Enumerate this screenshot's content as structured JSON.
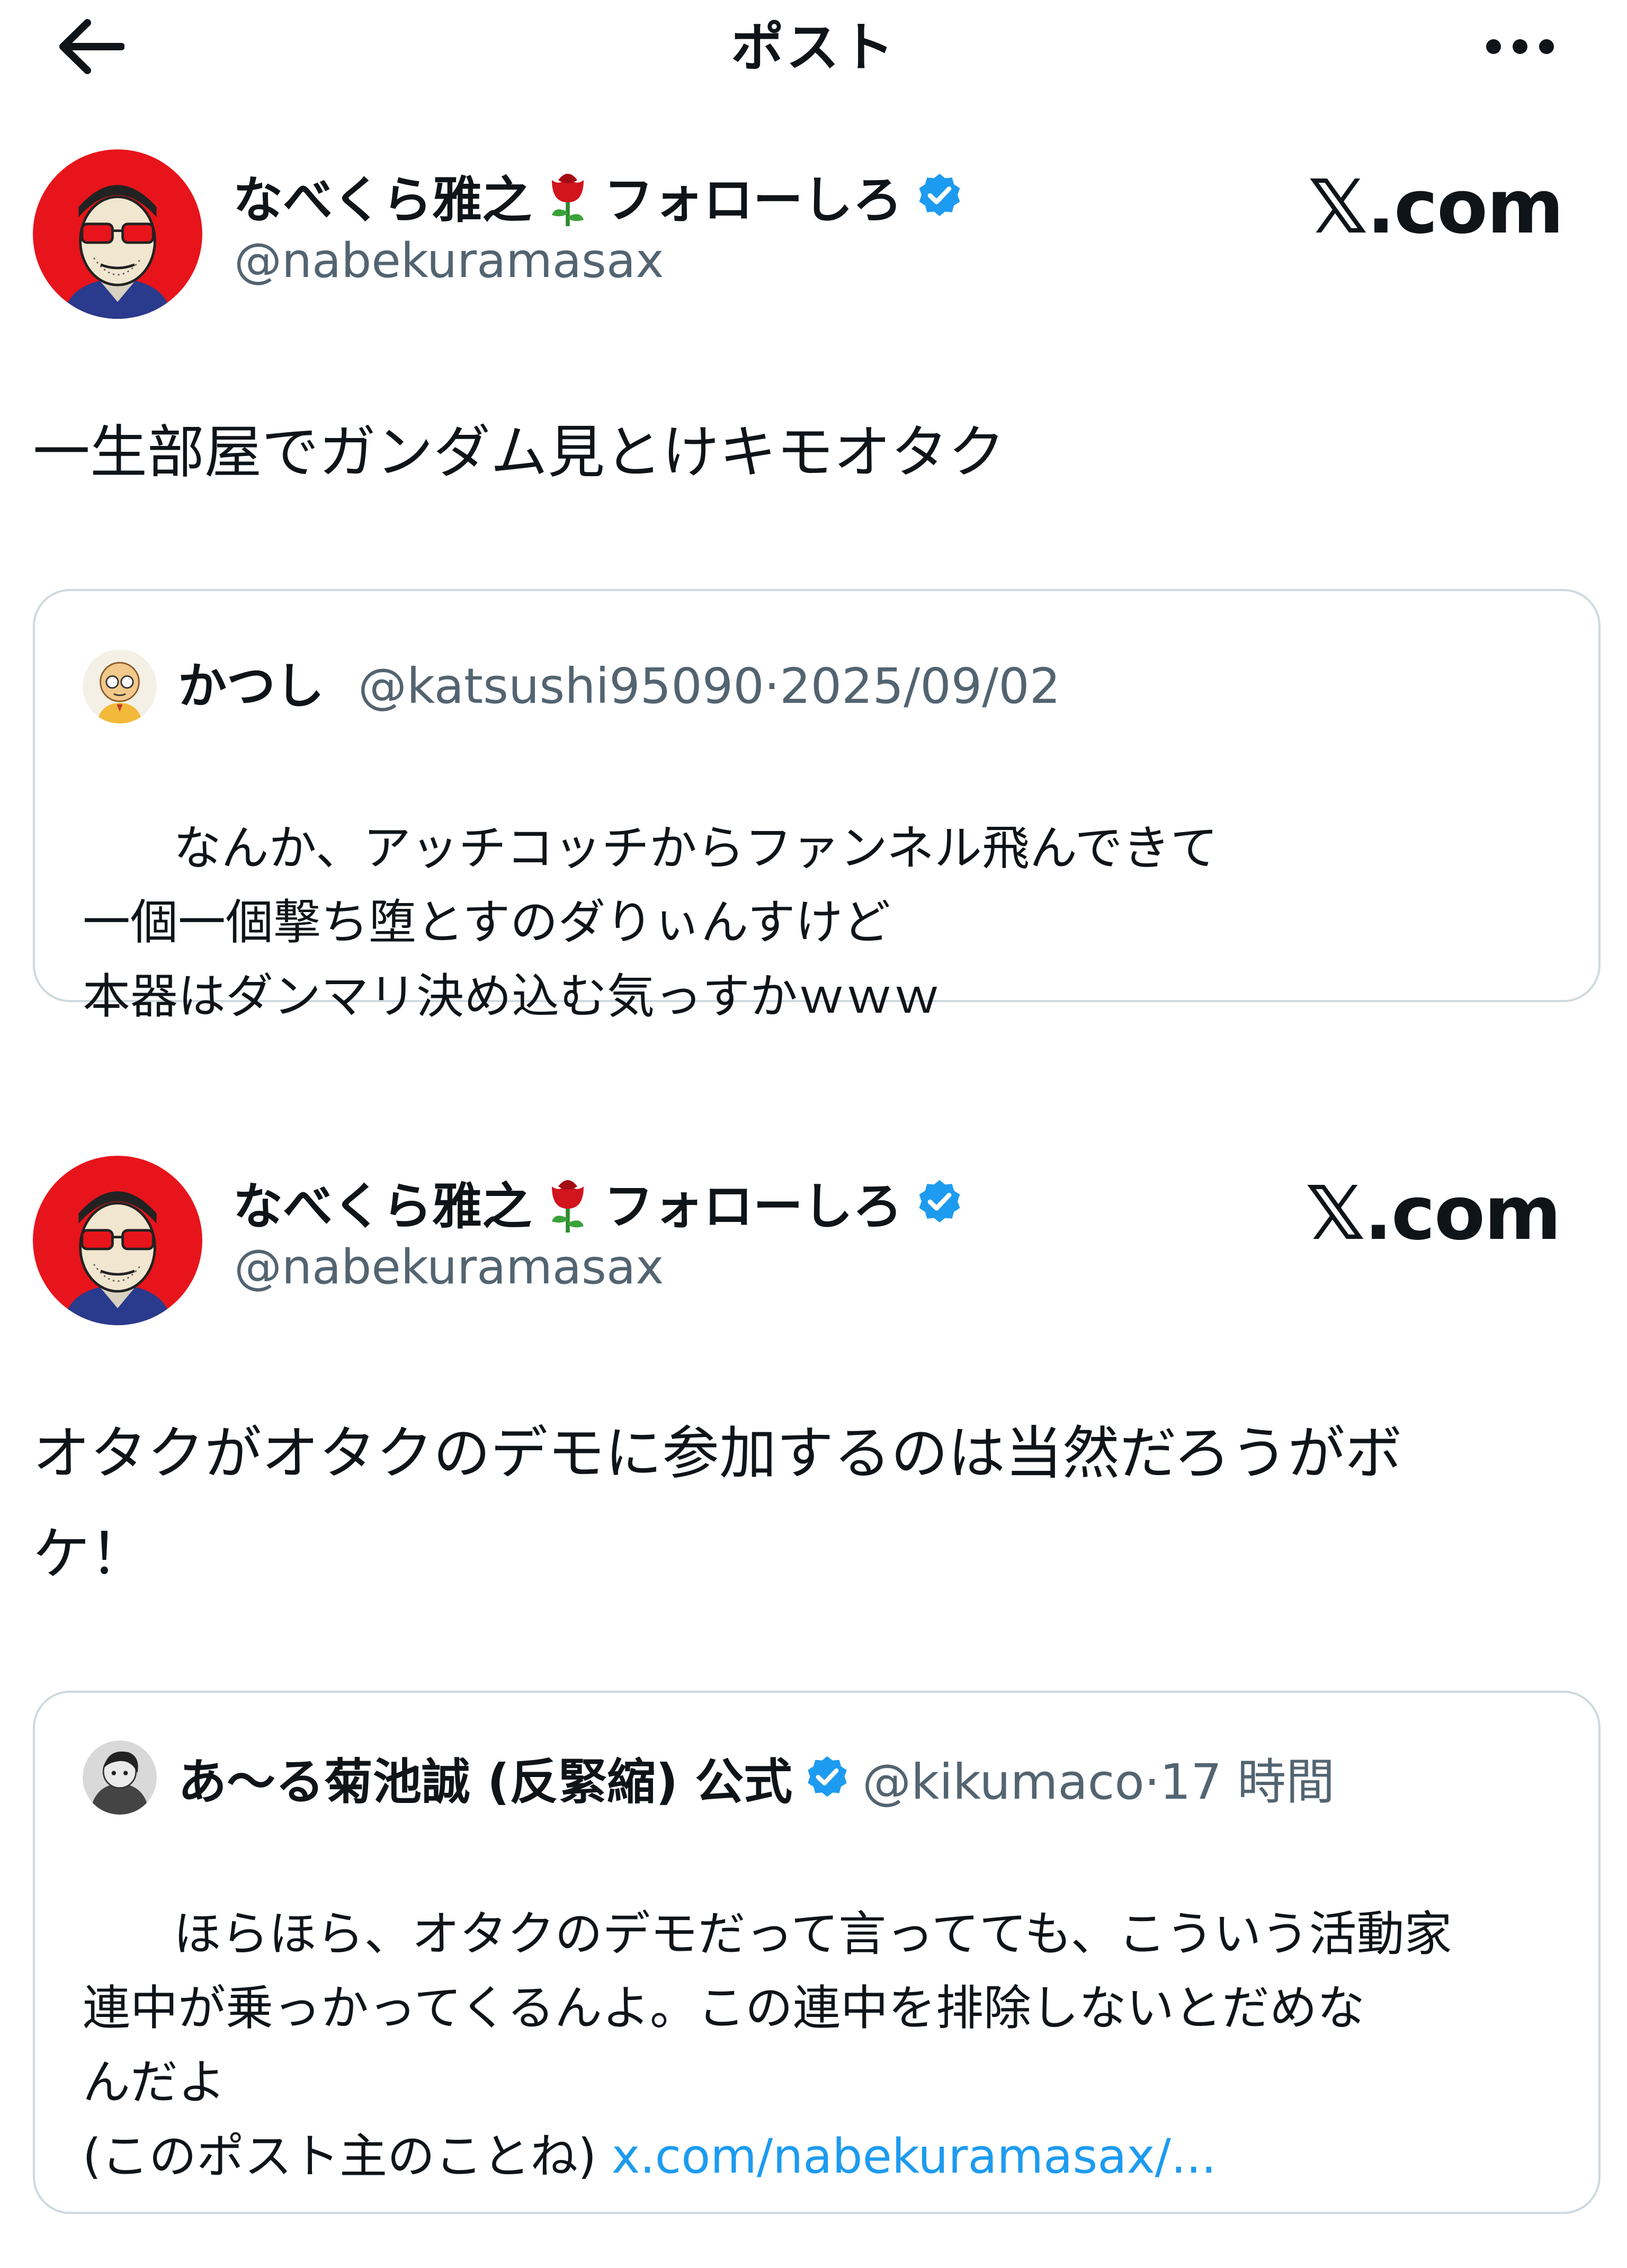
{
  "header": {
    "back_icon": "arrow-left-icon",
    "title": "ポスト",
    "more_icon": "more-dots-icon"
  },
  "posts": [
    {
      "author": {
        "name_prefix": "なべくら雅之",
        "emoji": "rose-icon",
        "name_suffix": "フォローしろ",
        "verified": true,
        "handle": "@nabekuramasax"
      },
      "source_logo": "𝕏.com",
      "text": "一生部屋でガンダム見とけキモオタク",
      "quote": {
        "name": "かつし",
        "handle": "@katsushi95090",
        "separator": "·",
        "date": "2025/09/02",
        "text": "なんか、アッチコッチからファンネル飛んできて\n一個一個撃ち堕とすのダりぃんすけど\n本器はダンマリ決め込む気っすかｗｗｗ",
        "link": ""
      }
    },
    {
      "author": {
        "name_prefix": "なべくら雅之",
        "emoji": "rose-icon",
        "name_suffix": "フォローしろ",
        "verified": true,
        "handle": "@nabekuramasax"
      },
      "source_logo": "𝕏.com",
      "text": "オタクがオタクのデモに参加するのは当然だろうがボ\nケ！",
      "quote": {
        "name": "あ〜る菊池誠 (反緊縮) 公式",
        "verified": true,
        "handle": "@kikumaco",
        "separator": "·",
        "date": "17 時間",
        "text": "ほらほら、オタクのデモだって言ってても、こういう活動家\n連中が乗っかってくるんよ。この連中を排除しないとだめな\nんだよ\n(このポスト主のことね) ",
        "link": "x.com/nabekuramasax/..."
      }
    }
  ],
  "colors": {
    "text": "#0f1419",
    "secondary": "#536471",
    "link": "#1d9bf0",
    "verified": "#1d9bf0",
    "border": "#cfd9de"
  }
}
